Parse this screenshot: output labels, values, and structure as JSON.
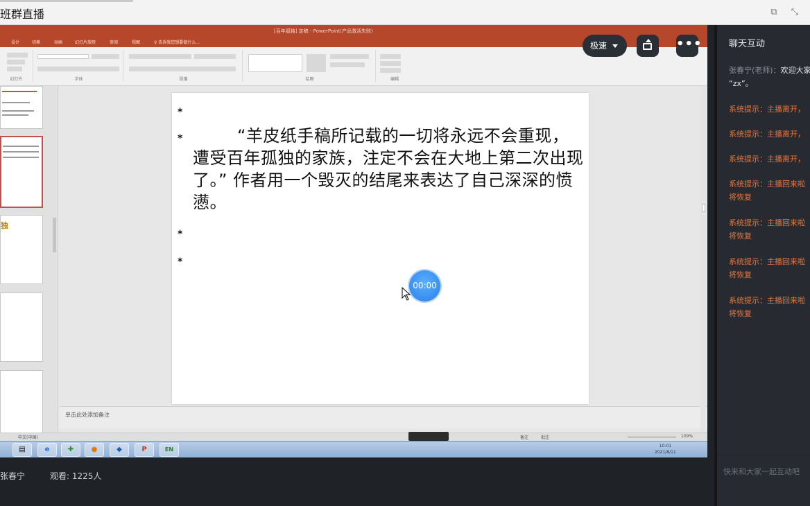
{
  "window": {
    "title": "班群直播",
    "icons": [
      "popout-icon",
      "fullscreen-icon"
    ]
  },
  "ppt": {
    "caption": "[百年孤独] 定稿 - PowerPoint(产品激活失败)",
    "tabs": [
      "设计",
      "切换",
      "动画",
      "幻灯片放映",
      "审阅",
      "视图",
      "♀ 告诉我您想要做什么..."
    ],
    "ribbon_groups": [
      "幻灯片",
      "字体",
      "段落",
      "绘图",
      "编辑"
    ],
    "notes_placeholder": "单击此处添加备注",
    "status_left": "中文(中国)",
    "status_right": [
      "备注",
      "批注"
    ],
    "zoom": "109%",
    "taskbar_time": [
      "10:01",
      "2021/8/11"
    ],
    "taskbar_lang": "EN"
  },
  "slide": {
    "bullets": [
      "*",
      "*",
      "*",
      "*"
    ],
    "body": "“羊皮纸手稿所记载的一切将永远不会重现，遭受百年孤独的家族，注定不会在大地上第二次出现了。” 作者用一个毁灭的结尾来表达了自己深深的愤懑。",
    "thumb_word": "独"
  },
  "overlay": {
    "speed_label": "极速",
    "timer": "00:00"
  },
  "info": {
    "host": "张春宁",
    "viewers": "观看: 1225人"
  },
  "chat": {
    "title": "聊天互动",
    "messages": [
      {
        "author": "张春宁(老师)：",
        "text": "欢迎大家",
        "text2": "“zx”。"
      },
      {
        "sys": "系统提示：主播离开，"
      },
      {
        "sys": "系统提示：主播离开，"
      },
      {
        "sys": "系统提示：主播离开，"
      },
      {
        "sys": "系统提示：主播回来啦",
        "sys2": "将恢复"
      },
      {
        "sys": "系统提示：主播回来啦",
        "sys2": "将恢复"
      },
      {
        "sys": "系统提示：主播回来啦",
        "sys2": "将恢复"
      },
      {
        "sys": "系统提示：主播回来啦",
        "sys2": "将恢复"
      }
    ],
    "input_placeholder": "快来和大家一起互动吧"
  }
}
